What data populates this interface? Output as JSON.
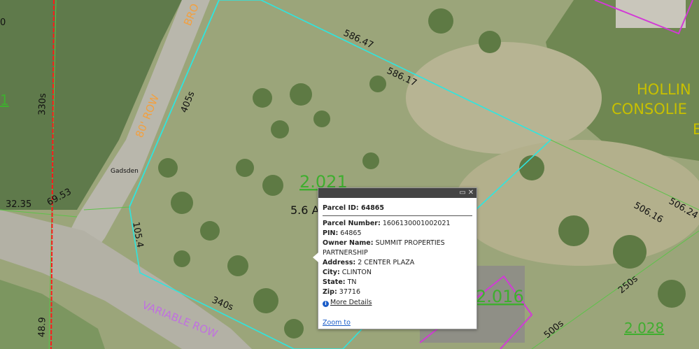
{
  "map": {
    "labels": {
      "broad_st": "BRO",
      "row_80": "80' ROW",
      "variable_row": "VARIABLE  ROW",
      "gadsden": "Gadsden",
      "hollins_1": "HOLLIN",
      "hollins_2": "CONSOLIE",
      "hollins_3": "E",
      "left_num": "0",
      "left_edge": "1"
    },
    "dims": {
      "d58647": "586.47",
      "d58617": "586.17",
      "d405s": "405s",
      "d330s": "330s",
      "d3235": "32.35",
      "d6953": "69.53",
      "d1054": "105.4",
      "d340s": "340s",
      "d489": "48.9",
      "d50616": "506.16",
      "d50624": "506.24",
      "d250s": "250s",
      "d500s": "500s"
    },
    "acreage": {
      "a2021": "2.021",
      "a2016": "2.016",
      "a2028": "2.028",
      "area": "5.6 A"
    },
    "colors": {
      "parcel": "#2ee6e0",
      "pink": "#d23ad6",
      "road_red": "#ff1a1a",
      "acre_green": "#3fae2f",
      "row_orange": "#f2a040",
      "hollins_text": "#c8c000"
    }
  },
  "popup": {
    "title": "Parcel ID: 64865",
    "fields": [
      {
        "label": "Parcel Number:",
        "value": "1606130001002021"
      },
      {
        "label": "PIN:",
        "value": "64865"
      },
      {
        "label": "Owner Name:",
        "value": "SUMMIT PROPERTIES PARTNERSHIP"
      },
      {
        "label": "Address:",
        "value": "2 CENTER PLAZA"
      },
      {
        "label": "City:",
        "value": "CLINTON"
      },
      {
        "label": "State:",
        "value": "TN"
      },
      {
        "label": "Zip:",
        "value": "37716"
      }
    ],
    "more_details": "More Details",
    "zoom_to": "Zoom to",
    "maximize_icon": "maximize-icon",
    "close_icon": "close-icon"
  }
}
